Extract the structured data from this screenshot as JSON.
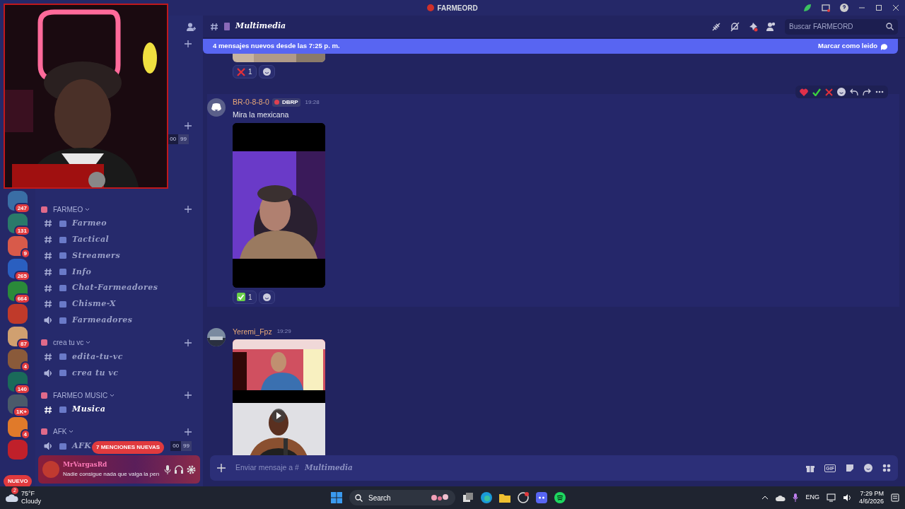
{
  "title_bar": {
    "title": "FARMEORD"
  },
  "webcam": {
    "kind": "picture"
  },
  "servers": [
    {
      "badge": "247",
      "color": "#3a6ea5"
    },
    {
      "badge": "131",
      "color": "#2a7a6a"
    },
    {
      "badge": "9",
      "color": "#d85a4a"
    },
    {
      "badge": "265",
      "color": "#2a5fc0"
    },
    {
      "badge": "664",
      "color": "#2a8a3a"
    },
    {
      "color": "#c03a2a"
    },
    {
      "badge": "87",
      "color": "#d0a070"
    },
    {
      "badge": "4",
      "color": "#8a5a3a"
    },
    {
      "badge": "140",
      "color": "#1a6a5a"
    },
    {
      "badge": "1K+",
      "color": "#4a5a6a"
    },
    {
      "badge": "4",
      "color": "#e07a2a"
    },
    {
      "color": "#c0202a"
    }
  ],
  "new_pill": "NUEVO",
  "sidebar_top": {
    "counter": [
      "00",
      "99"
    ]
  },
  "categories": [
    {
      "name": "FARMEO",
      "channels": [
        {
          "kind": "text",
          "name": "Farmeo",
          "unread": false
        },
        {
          "kind": "text",
          "name": "Tactical",
          "unread": false
        },
        {
          "kind": "text",
          "name": "Streamers",
          "unread": false
        },
        {
          "kind": "text",
          "name": "Info",
          "unread": false
        },
        {
          "kind": "text",
          "name": "Chat-Farmeadores",
          "unread": false
        },
        {
          "kind": "text",
          "name": "Chisme-X",
          "unread": false
        },
        {
          "kind": "voice",
          "name": "Farmeadores",
          "unread": false
        }
      ]
    },
    {
      "name": "crea tu vc",
      "channels": [
        {
          "kind": "text",
          "name": "edita-tu-vc",
          "unread": false
        },
        {
          "kind": "voice",
          "name": "crea tu vc",
          "unread": false
        }
      ]
    },
    {
      "name": "FARMEO MUSIC",
      "channels": [
        {
          "kind": "text",
          "name": "Musica",
          "unread": true
        }
      ]
    },
    {
      "name": "AFK",
      "channels": [
        {
          "kind": "voice",
          "name": "AFK",
          "unread": false,
          "counter": [
            "00",
            "99"
          ]
        }
      ]
    }
  ],
  "mentions_pill": "7 MENCIONES NUEVAS",
  "user_panel": {
    "name": "MrVargasRd",
    "status": "Nadie consigue nada que valga la pen"
  },
  "channel_header": {
    "name": "Multimedia",
    "search": {
      "placeholder": "Buscar FARMEORD"
    }
  },
  "new_messages_bar": {
    "text": "4 mensajes nuevos desde las 7:25 p. m.",
    "action": "Marcar como leido"
  },
  "previous_reactions": [
    {
      "kind": "cross",
      "count": "1"
    }
  ],
  "messages": [
    {
      "author": "BR-0-8-8-0",
      "tag": "DBRP",
      "time": "19:28",
      "text": "Mira la mexicana",
      "avatar": {
        "kind": "logo"
      },
      "attachments": [
        {
          "kind": "picture"
        }
      ],
      "reactions": [
        {
          "kind": "check",
          "count": "1"
        }
      ],
      "hovered": true
    },
    {
      "author": "Yeremi_Fpz",
      "time": "19:29",
      "avatar": {
        "kind": "picture"
      },
      "attachments": [
        {
          "kind": "picture"
        },
        {
          "kind": "picture"
        }
      ],
      "hovered": false
    }
  ],
  "composer": {
    "placeholder": "Enviar mensaje a #",
    "channel": "Multimedia",
    "gif": "GIF"
  },
  "taskbar": {
    "temperature": "75°F",
    "weather": "Cloudy",
    "weather_badge": "2",
    "search": "Search",
    "language": "ENG",
    "time": "7:29 PM",
    "date": "4/6/2026"
  }
}
